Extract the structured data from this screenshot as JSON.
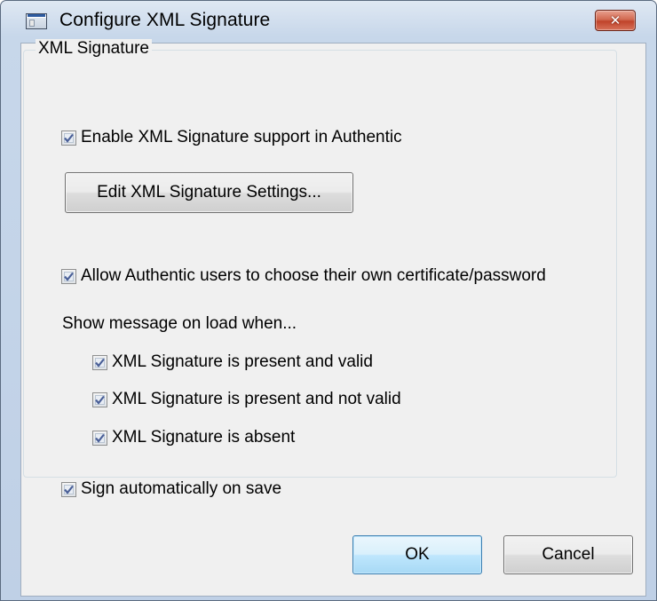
{
  "window": {
    "title": "Configure XML Signature",
    "close_symbol": "✕",
    "app_icon": "window-icon"
  },
  "group": {
    "label": "XML Signature"
  },
  "enable_support": {
    "label": "Enable XML Signature support in Authentic",
    "checked": true
  },
  "edit_settings_button": {
    "label": "Edit XML Signature Settings..."
  },
  "allow_choose": {
    "label": "Allow Authentic users to choose their own certificate/password",
    "checked": true
  },
  "show_message": {
    "label": "Show message on load when...",
    "options": [
      {
        "label": "XML Signature is present and valid",
        "checked": true
      },
      {
        "label": "XML Signature is present and not valid",
        "checked": true
      },
      {
        "label": "XML Signature is absent",
        "checked": true
      }
    ]
  },
  "sign_automatically": {
    "label": "Sign automatically on save",
    "checked": true
  },
  "buttons": {
    "ok": "OK",
    "cancel": "Cancel"
  },
  "colors": {
    "accent": "#3c7fb1",
    "checkmark": "#4a5f97",
    "close_button": "#c0432a"
  }
}
